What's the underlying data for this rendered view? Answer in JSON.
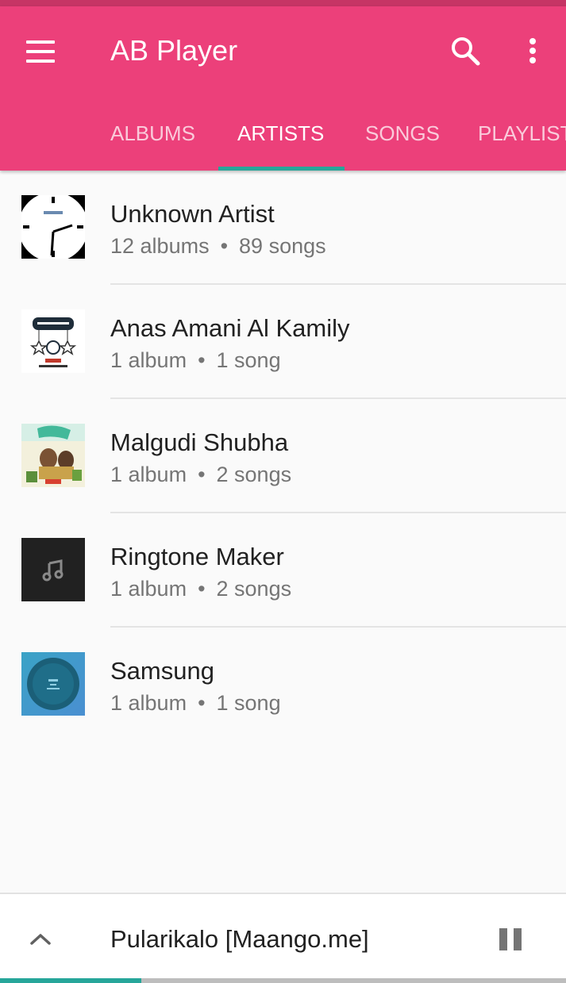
{
  "app": {
    "title": "AB Player",
    "accent_color": "#ec407a",
    "indicator_color": "#26a69a",
    "icons": [
      "hamburger-menu-icon",
      "search-icon",
      "more-vertical-icon",
      "chevron-up-icon",
      "pause-icon"
    ]
  },
  "tabs": [
    {
      "label": "ALBUMS",
      "active": false
    },
    {
      "label": "ARTISTS",
      "active": true
    },
    {
      "label": "SONGS",
      "active": false
    },
    {
      "label": "PLAYLISTS",
      "active": false
    }
  ],
  "artists": [
    {
      "name": "Unknown Artist",
      "albums": "12 albums",
      "songs": "89 songs",
      "thumb": "clock-artwork"
    },
    {
      "name": "Anas Amani Al Kamily",
      "albums": "1 album",
      "songs": "1 song",
      "thumb": "ramadan-artwork"
    },
    {
      "name": "Malgudi Shubha",
      "albums": "1 album",
      "songs": "2 songs",
      "thumb": "movie-poster-artwork"
    },
    {
      "name": "Ringtone Maker",
      "albums": "1 album",
      "songs": "2 songs",
      "thumb": "music-note-placeholder"
    },
    {
      "name": "Samsung",
      "albums": "1 album",
      "songs": "1 song",
      "thumb": "disc-artwork"
    }
  ],
  "separator": "•",
  "now_playing": {
    "title": "Pularikalo [Maango.me]",
    "progress": 0.25
  }
}
